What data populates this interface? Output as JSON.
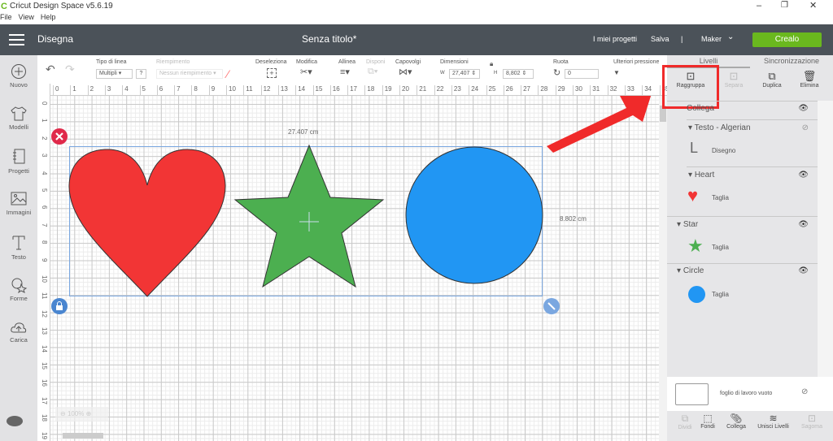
{
  "window": {
    "title": "Cricut Design Space  v5.6.19",
    "menu": [
      "File",
      "View",
      "Help"
    ]
  },
  "header": {
    "section": "Disegna",
    "doc_title": "Senza titolo*",
    "my_projects": "I miei progetti",
    "save": "Salva",
    "sep": "|",
    "machine": "Maker",
    "make": "Crealo",
    "make_color": "#6ab81e"
  },
  "sidebar": [
    {
      "label": "Nuovo",
      "icon": "plus-circle-icon"
    },
    {
      "label": "Modelli",
      "icon": "tshirt-icon"
    },
    {
      "label": "Progetti",
      "icon": "notebook-icon"
    },
    {
      "label": "Immagini",
      "icon": "image-icon"
    },
    {
      "label": "Testo",
      "icon": "text-icon"
    },
    {
      "label": "Forme",
      "icon": "shapes-icon"
    },
    {
      "label": "Carica",
      "icon": "cloud-upload-icon"
    }
  ],
  "toolbar": {
    "linetype_label": "Tipo di linea",
    "linetype_value": "Multipli",
    "help": "?",
    "fill_label": "Riempimento",
    "fill_value": "Nessun riempimento",
    "deselect": "Deseleziona",
    "edit": "Modifica",
    "align": "Allinea",
    "arrange": "Disponi",
    "flip": "Capovolgi",
    "size": "Dimensioni",
    "w_label": "W",
    "w_value": "27,407",
    "h_label": "H",
    "h_value": "8,802",
    "rotate": "Ruota",
    "rotate_value": "0",
    "more": "Ulteriori pressione"
  },
  "ruler": {
    "top": [
      0,
      1,
      2,
      3,
      4,
      5,
      6,
      7,
      8,
      9,
      10,
      11,
      12,
      13,
      14,
      15,
      16,
      17,
      18,
      19,
      20,
      21,
      22,
      23,
      24,
      25,
      26,
      27,
      28,
      29,
      30,
      31,
      32,
      33,
      34,
      35
    ],
    "left": [
      0,
      1,
      2,
      3,
      4,
      5,
      6,
      7,
      8,
      9,
      10,
      11,
      12,
      13,
      14,
      15,
      16,
      17,
      18,
      19
    ]
  },
  "canvas": {
    "width_label": "27.407 cm",
    "height_label": "8.802 cm",
    "zoom": "100%",
    "colors": {
      "heart": "#f23535",
      "star": "#4caf50",
      "circle": "#2196f3",
      "arrow": "#f02a2a"
    }
  },
  "panel": {
    "tabs": [
      "Livelli",
      "Sincronizzazione"
    ],
    "actions": [
      {
        "label": "Raggruppa",
        "enabled": true
      },
      {
        "label": "Separa",
        "enabled": false
      },
      {
        "label": "Duplica",
        "enabled": true
      },
      {
        "label": "Elimina",
        "enabled": true
      }
    ],
    "layers": [
      {
        "name": "Collega"
      },
      {
        "name": "Testo - Algerian",
        "sub": "Disegno"
      },
      {
        "name": "Heart",
        "sub": "Taglia"
      },
      {
        "name": "Star",
        "sub": "Taglia"
      },
      {
        "name": "Circle",
        "sub": "Taglia"
      }
    ],
    "sheet": "foglio di lavoro vuoto",
    "bottom": [
      {
        "label": "Dividi",
        "enabled": false
      },
      {
        "label": "Fondi",
        "enabled": true
      },
      {
        "label": "Collega",
        "enabled": true
      },
      {
        "label": "Unisci Livelli",
        "enabled": true
      },
      {
        "label": "Sagoma",
        "enabled": false
      }
    ]
  }
}
